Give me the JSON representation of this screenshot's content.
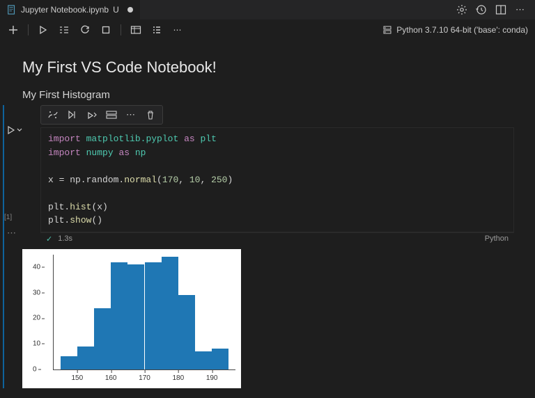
{
  "tab": {
    "filename": "Jupyter Notebook.ipynb",
    "vcs_status": "U",
    "unsaved": true
  },
  "tab_actions": {
    "settings_icon": "settings-gear",
    "history_icon": "history",
    "layout_icon": "editor-layout",
    "more_icon": "more"
  },
  "toolbar": {
    "add_icon": "add",
    "run_all_icon": "run-all",
    "clear_outputs_icon": "clear-all",
    "restart_icon": "restart",
    "interrupt_icon": "interrupt",
    "variables_icon": "variables",
    "outline_icon": "outline",
    "more_icon": "more"
  },
  "kernel": {
    "label": "Python 3.7.10 64-bit ('base': conda)"
  },
  "markdown": {
    "h1": "My First VS Code Notebook!",
    "h2": "My First Histogram"
  },
  "cell_toolbar": {
    "python_icon": "python",
    "run_by_line_icon": "run-by-line",
    "execute_above_icon": "execute-above",
    "split_icon": "split-cell",
    "more_icon": "more",
    "delete_icon": "delete"
  },
  "cell": {
    "run_icon": "run",
    "chevron_icon": "chevron-down",
    "execution_count": "[1]",
    "more_icon": "⋯",
    "code_tokens": [
      [
        [
          "import",
          "kw"
        ],
        [
          " "
        ],
        [
          "matplotlib.pyplot",
          "mod"
        ],
        [
          " "
        ],
        [
          "as",
          "kw"
        ],
        [
          " "
        ],
        [
          "plt",
          "mod"
        ]
      ],
      [
        [
          "import",
          "kw"
        ],
        [
          " "
        ],
        [
          "numpy",
          "mod"
        ],
        [
          " "
        ],
        [
          "as",
          "kw"
        ],
        [
          " "
        ],
        [
          "np",
          "mod"
        ]
      ],
      [],
      [
        [
          "x = np.random."
        ],
        [
          "normal",
          "fn"
        ],
        [
          "("
        ],
        [
          "170",
          "num"
        ],
        [
          ", "
        ],
        [
          "10",
          "num"
        ],
        [
          ", "
        ],
        [
          "250",
          "num"
        ],
        [
          ")"
        ]
      ],
      [],
      [
        [
          "plt."
        ],
        [
          "hist",
          "fn"
        ],
        [
          "(x)"
        ]
      ],
      [
        [
          "plt."
        ],
        [
          "show",
          "fn"
        ],
        [
          "()"
        ]
      ]
    ],
    "status": {
      "ok_icon": "✓",
      "time": "1.3s",
      "language": "Python"
    }
  },
  "chart_data": {
    "type": "bar",
    "categories": [
      145,
      150,
      155,
      160,
      165,
      170,
      175,
      180,
      185,
      190
    ],
    "values": [
      5,
      9,
      24,
      42,
      41,
      42,
      44,
      29,
      7,
      8
    ],
    "xticks": [
      150,
      160,
      170,
      180,
      190
    ],
    "yticks": [
      0,
      10,
      20,
      30,
      40
    ],
    "title": "",
    "xlabel": "",
    "ylabel": "",
    "ylim": [
      0,
      45
    ],
    "xlim": [
      143,
      197
    ]
  }
}
